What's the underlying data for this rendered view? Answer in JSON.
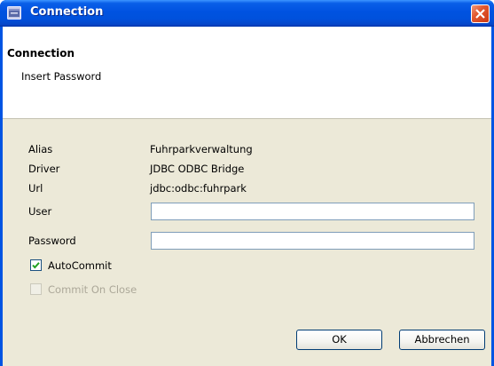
{
  "window": {
    "title": "Connection",
    "icon": "eclipse-app-icon"
  },
  "banner": {
    "title": "Connection",
    "message": "Insert Password"
  },
  "info": {
    "alias_label": "Alias",
    "alias_value": "Fuhrparkverwaltung",
    "driver_label": "Driver",
    "driver_value": "JDBC ODBC Bridge",
    "url_label": "Url",
    "url_value": "jdbc:odbc:fuhrpark"
  },
  "form": {
    "user_label": "User",
    "user_value": "",
    "password_label": "Password",
    "password_value": ""
  },
  "options": {
    "autocommit_label": "AutoCommit",
    "autocommit_checked": true,
    "commit_on_close_label": "Commit On Close",
    "commit_on_close_checked": false,
    "commit_on_close_enabled": false
  },
  "buttons": {
    "ok": "OK",
    "cancel": "Abbrechen"
  },
  "colors": {
    "titlebar": "#0054e3",
    "client": "#ece9d8",
    "close": "#e2582f"
  }
}
